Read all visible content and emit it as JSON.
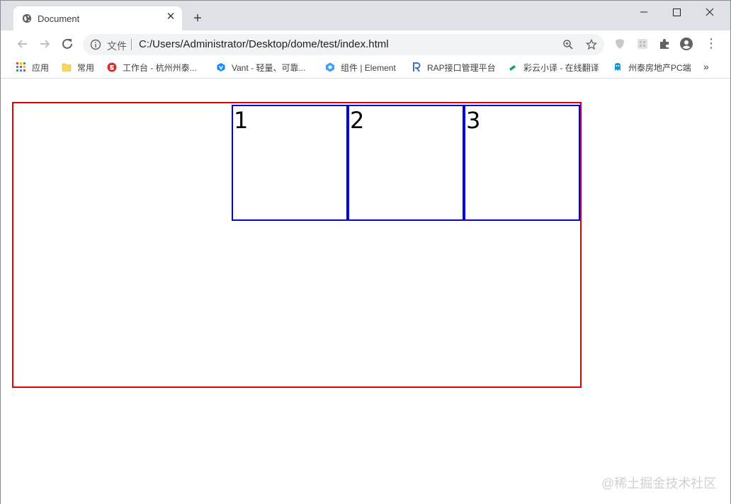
{
  "browser": {
    "tab": {
      "title": "Document",
      "close_symbol": "✕"
    },
    "new_tab_symbol": "+",
    "window_controls": {
      "minimize": "—",
      "maximize": "☐",
      "close": "✕"
    },
    "address": {
      "security_label": "文件",
      "url": "C:/Users/Administrator/Desktop/dome/test/index.html"
    },
    "more_symbol": "⋮"
  },
  "bookmarks": {
    "items": [
      {
        "label": "应用",
        "icon": "apps-grid-icon",
        "color": "#ea4335"
      },
      {
        "label": "常用",
        "icon": "folder-icon",
        "color": "#f9d65c"
      },
      {
        "label": "工作台 - 杭州州泰...",
        "icon": "work-logo-icon",
        "color": "#d32f2f"
      },
      {
        "label": "Vant - 轻量、可靠...",
        "icon": "vant-logo-icon",
        "color": "#1989fa"
      },
      {
        "label": "组件 | Element",
        "icon": "element-logo-icon",
        "color": "#409eff"
      },
      {
        "label": "RAP接口管理平台",
        "icon": "rap-logo-icon",
        "color": "#3b73c9"
      },
      {
        "label": "彩云小译 - 在线翻译",
        "icon": "caiyun-logo-icon",
        "color": "#1aa260"
      },
      {
        "label": "州泰房地产PC端",
        "icon": "bird-logo-icon",
        "color": "#1296db"
      }
    ],
    "more_symbol": "»"
  },
  "page": {
    "boxes": [
      "1",
      "2",
      "3"
    ],
    "container_border_color": "#e00000",
    "box_border_color": "#0000e0"
  },
  "watermark": "@稀土掘金技术社区"
}
